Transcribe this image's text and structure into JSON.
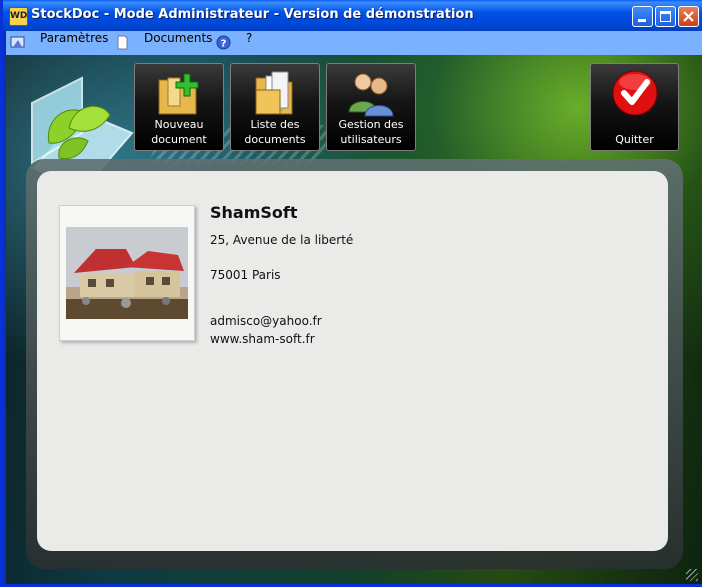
{
  "window": {
    "title": "StockDoc - Mode Administrateur - Version de démonstration",
    "app_icon_text": "WD"
  },
  "menu": {
    "items": [
      {
        "label": "Paramètres",
        "icon": "settings-icon"
      },
      {
        "label": "Documents",
        "icon": "document-icon"
      },
      {
        "label": "?",
        "icon": "help-icon"
      }
    ]
  },
  "toolbar": {
    "new_document": "Nouveau\ndocument",
    "document_list": "Liste des\ndocuments",
    "user_management": "Gestion des\nutilisateurs",
    "quit": "Quitter"
  },
  "company": {
    "name": "ShamSoft",
    "address_line1": "25,  Avenue de la liberté",
    "postal_city": "75001 Paris",
    "email": "admisco@yahoo.fr",
    "website": "www.sham-soft.fr"
  },
  "colors": {
    "title_bar": "#0054e3",
    "menu_bar": "#7ab2ff",
    "panel": "#eaebe9",
    "quit_red": "#e01010"
  }
}
